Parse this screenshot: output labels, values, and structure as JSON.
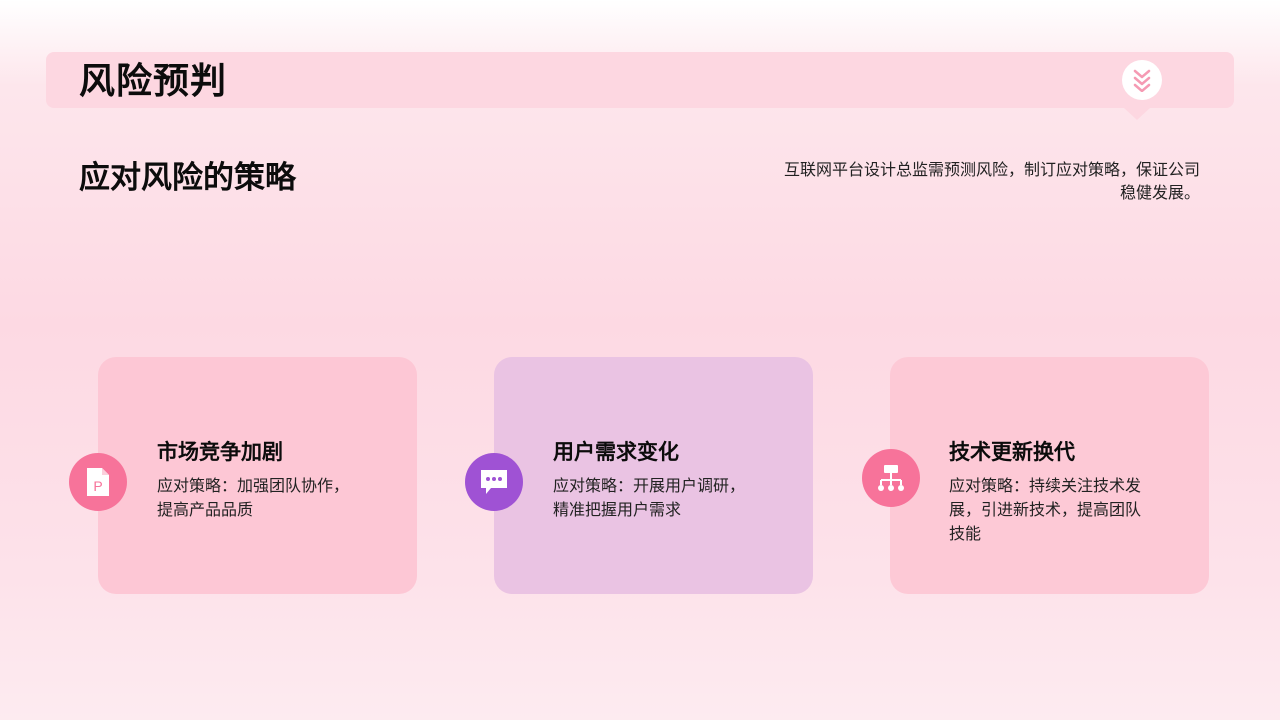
{
  "header": {
    "title": "风险预判",
    "badge_icon": "double-chevron-down-icon"
  },
  "section": {
    "subtitle": "应对风险的策略",
    "description": "互联网平台设计总监需预测风险，制订应对策略，保证公司稳健发展。"
  },
  "cards": [
    {
      "title": "市场竞争加剧",
      "text": "应对策略：加强团队协作，提高产品品质",
      "icon": "powerpoint-file-icon",
      "color": "#f7739a"
    },
    {
      "title": "用户需求变化",
      "text": "应对策略：开展用户调研，精准把握用户需求",
      "icon": "chat-bubble-icon",
      "color": "#9f52d4"
    },
    {
      "title": "技术更新换代",
      "text": "应对策略：持续关注技术发展，引进新技术，提高团队技能",
      "icon": "network-hierarchy-icon",
      "color": "#f7739a"
    }
  ]
}
